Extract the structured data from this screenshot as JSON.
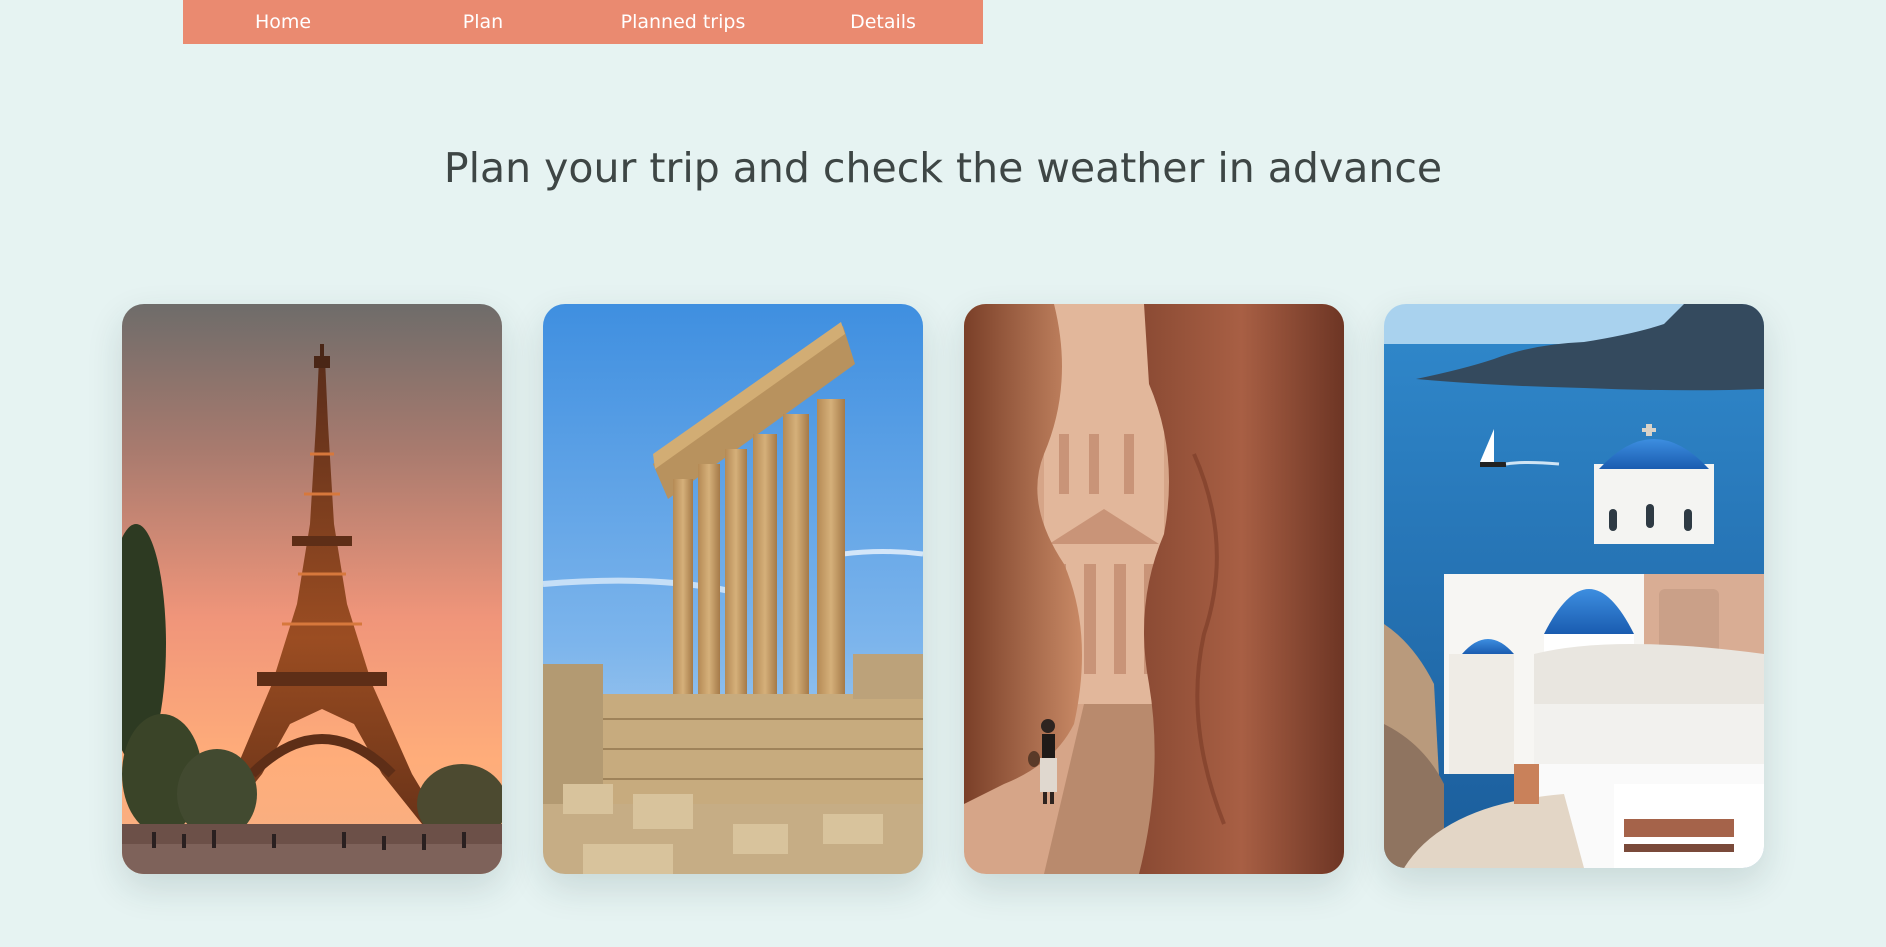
{
  "nav": {
    "items": [
      {
        "label": "Home"
      },
      {
        "label": "Plan"
      },
      {
        "label": "Planned trips"
      },
      {
        "label": "Details"
      }
    ]
  },
  "hero": {
    "title": "Plan your trip and check the weather in advance"
  },
  "colors": {
    "nav_bg": "#ea8a70",
    "page_bg": "#e6f3f2",
    "title": "#3e4645"
  },
  "cards": [
    {
      "image": "eiffel-tower-sunset-photo"
    },
    {
      "image": "roman-temple-columns-photo"
    },
    {
      "image": "petra-siq-canyon-photo"
    },
    {
      "image": "santorini-blue-domes-photo"
    }
  ]
}
